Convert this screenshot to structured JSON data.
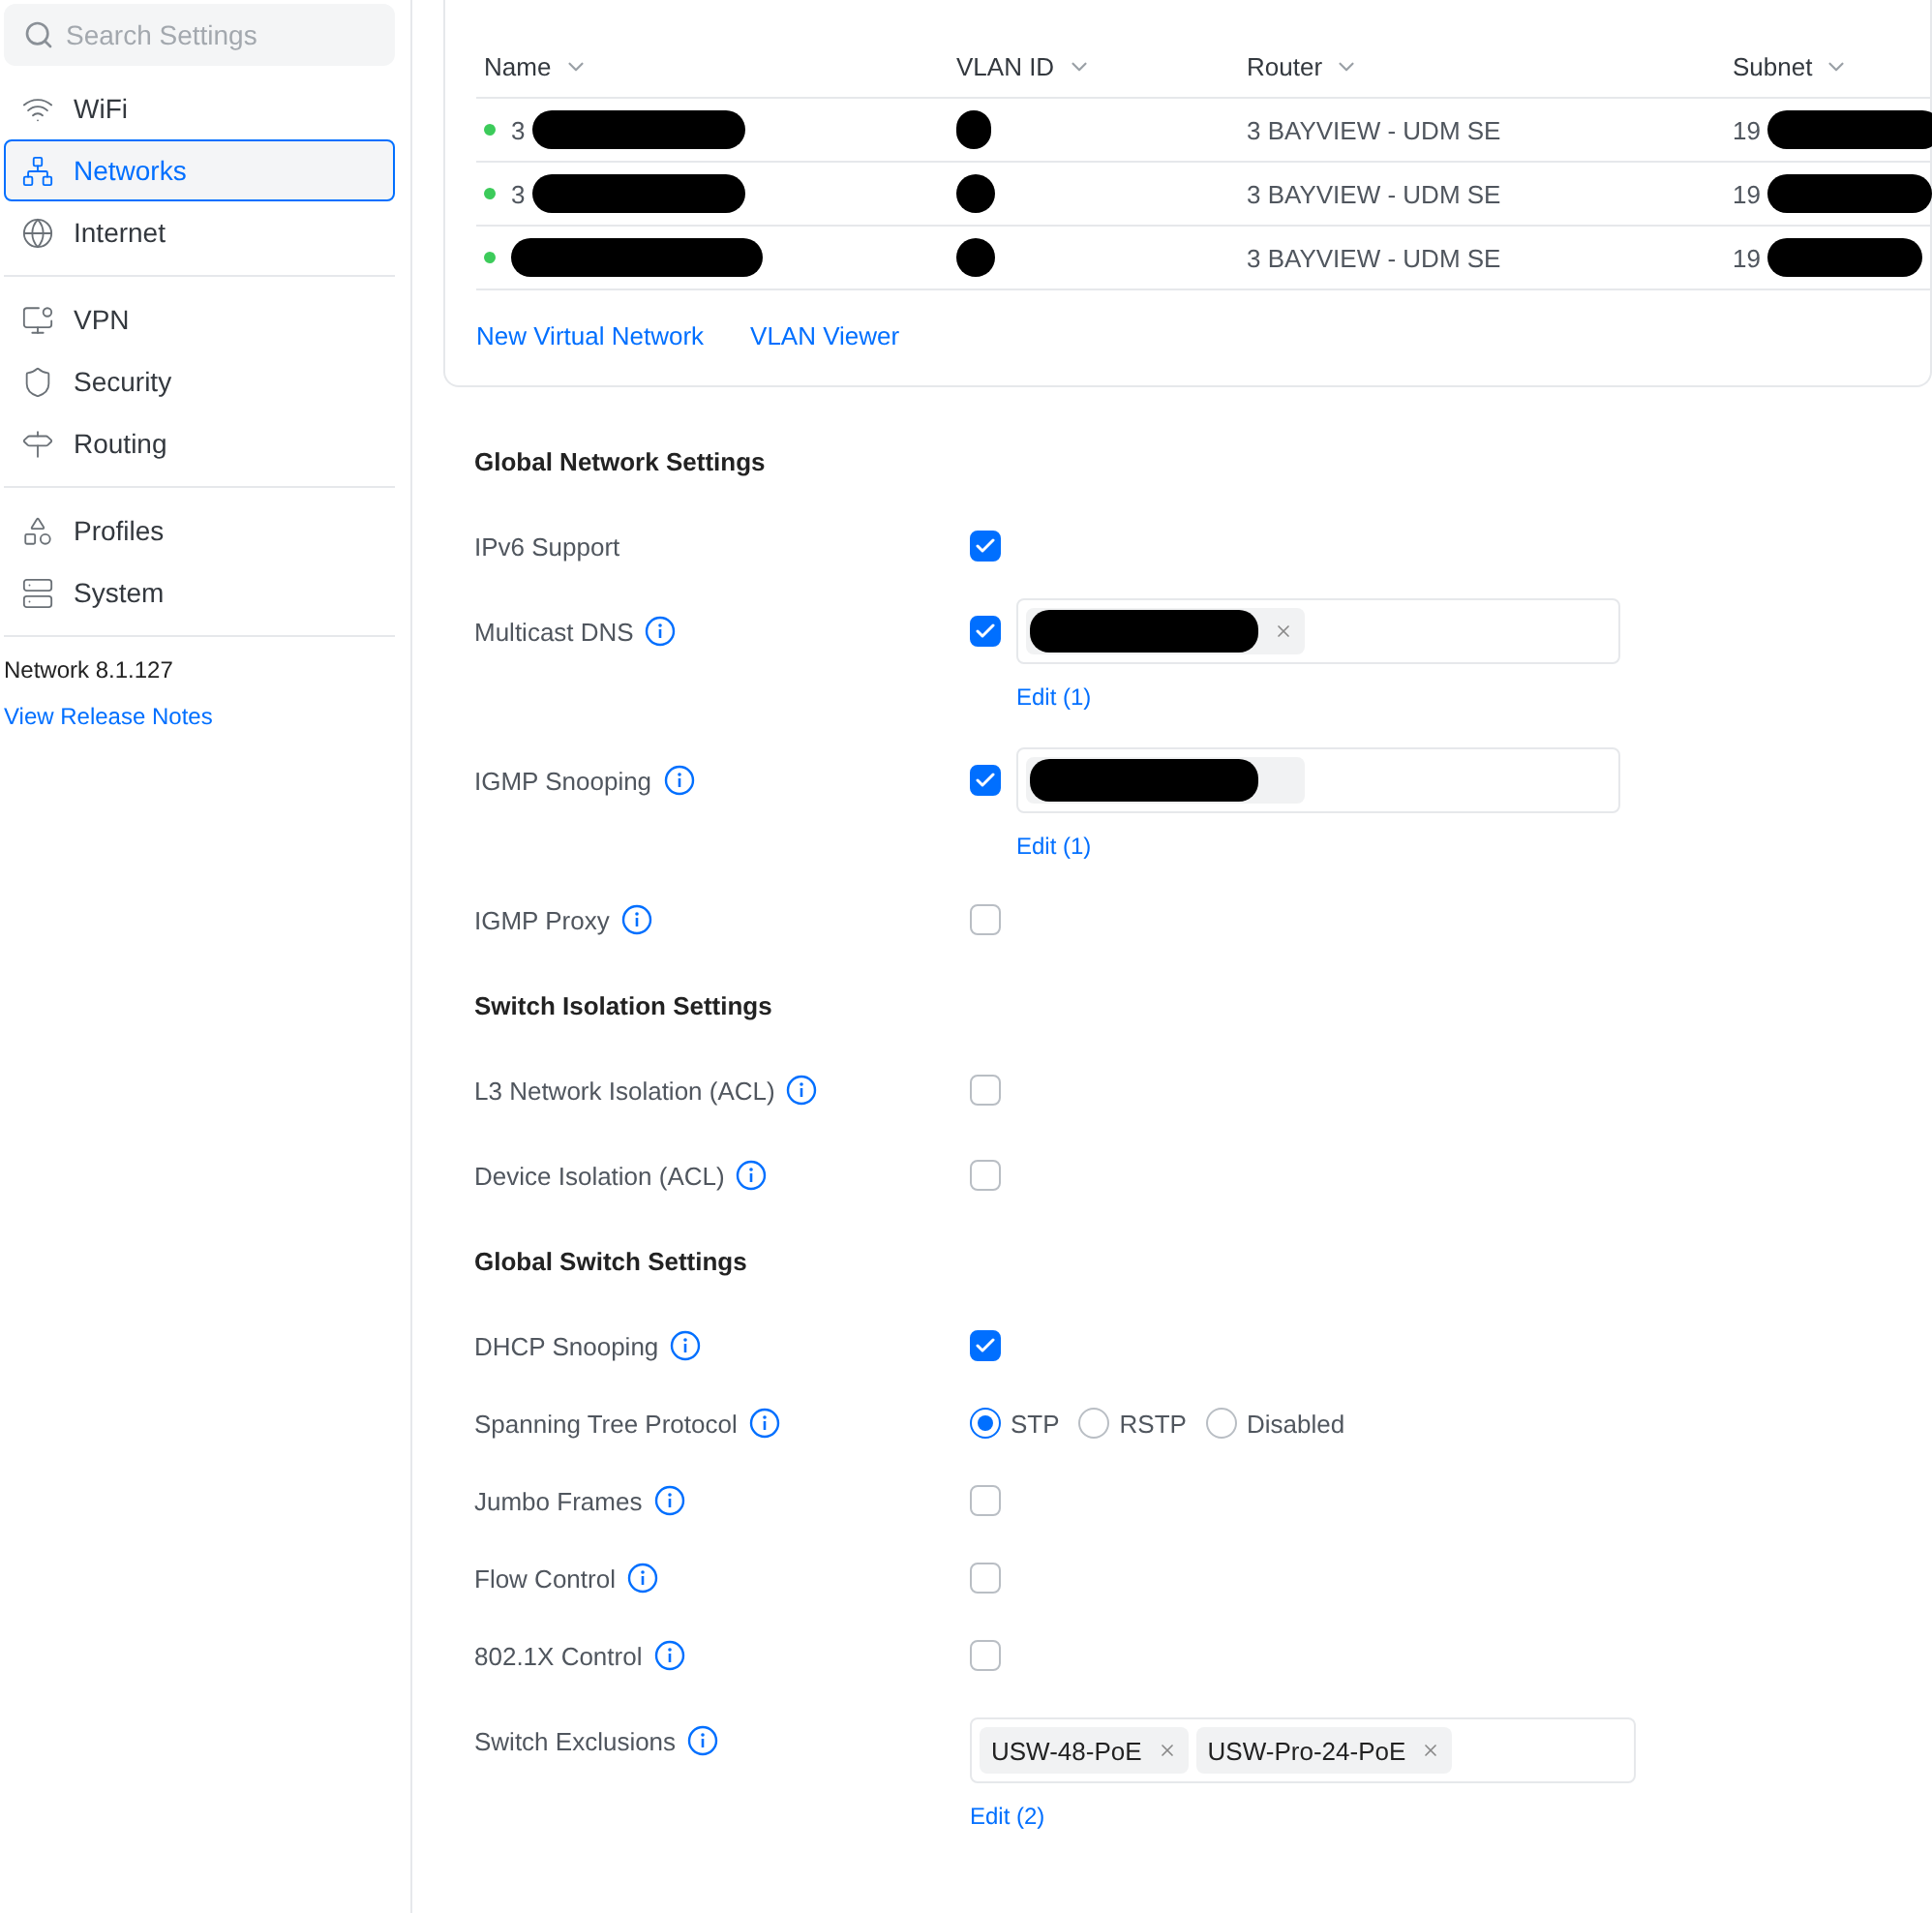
{
  "sidebar": {
    "search": {
      "placeholder": "Search Settings"
    },
    "groups": [
      [
        {
          "label": "WiFi",
          "selected": false
        },
        {
          "label": "Networks",
          "selected": true
        },
        {
          "label": "Internet",
          "selected": false
        }
      ],
      [
        {
          "label": "VPN",
          "selected": false
        },
        {
          "label": "Security",
          "selected": false
        },
        {
          "label": "Routing",
          "selected": false
        }
      ],
      [
        {
          "label": "Profiles",
          "selected": false
        },
        {
          "label": "System",
          "selected": false
        }
      ]
    ],
    "version": "Network 8.1.127",
    "release_notes_link": "View Release Notes"
  },
  "table": {
    "columns": [
      "Name",
      "VLAN ID",
      "Router",
      "Subnet"
    ],
    "rows": [
      {
        "name": "3",
        "router": "3 BAYVIEW - UDM SE",
        "subnet": "19"
      },
      {
        "name": "3",
        "router": "3 BAYVIEW - UDM SE",
        "subnet": "19"
      },
      {
        "router": "3 BAYVIEW - UDM SE",
        "subnet": "19"
      }
    ],
    "links": [
      "New Virtual Network",
      "VLAN Viewer"
    ]
  },
  "settings": [
    {
      "kind": "heading",
      "label": "Global Network Settings"
    },
    {
      "kind": "checkbox",
      "label": "IPv6 Support",
      "info": false,
      "checked": true
    },
    {
      "kind": "tags",
      "label": "Multicast DNS",
      "info": true,
      "checked": true,
      "tags": [
        {
          "kind": "redacted",
          "removable": true
        }
      ],
      "edit": "Edit (1)"
    },
    {
      "kind": "tags",
      "label": "IGMP Snooping",
      "info": true,
      "checked": true,
      "tags": [
        {
          "kind": "redacted",
          "removable": false
        }
      ],
      "edit": "Edit (1)"
    },
    {
      "kind": "checkbox",
      "label": "IGMP Proxy",
      "info": true,
      "checked": false
    },
    {
      "kind": "heading",
      "label": "Switch Isolation Settings"
    },
    {
      "kind": "checkbox",
      "label": "L3 Network Isolation (ACL)",
      "info": true,
      "checked": false
    },
    {
      "kind": "checkbox",
      "label": "Device Isolation (ACL)",
      "info": true,
      "checked": false
    },
    {
      "kind": "heading",
      "label": "Global Switch Settings"
    },
    {
      "kind": "checkbox",
      "label": "DHCP Snooping",
      "info": true,
      "checked": true
    },
    {
      "kind": "radio",
      "label": "Spanning Tree Protocol",
      "info": true,
      "options": [
        {
          "label": "STP",
          "selected": true
        },
        {
          "label": "RSTP",
          "selected": false
        },
        {
          "label": "Disabled",
          "selected": false
        }
      ]
    },
    {
      "kind": "checkbox",
      "label": "Jumbo Frames",
      "info": true,
      "checked": false
    },
    {
      "kind": "checkbox",
      "label": "Flow Control",
      "info": true,
      "checked": false
    },
    {
      "kind": "checkbox",
      "label": "802.1X Control",
      "info": true,
      "checked": false
    },
    {
      "kind": "switch_tags",
      "label": "Switch Exclusions",
      "info": true,
      "tags": [
        {
          "kind": "text",
          "text": "USW-48-PoE",
          "removable": true
        },
        {
          "kind": "text",
          "text": "USW-Pro-24-PoE",
          "removable": true
        }
      ],
      "edit": "Edit (2)"
    }
  ]
}
